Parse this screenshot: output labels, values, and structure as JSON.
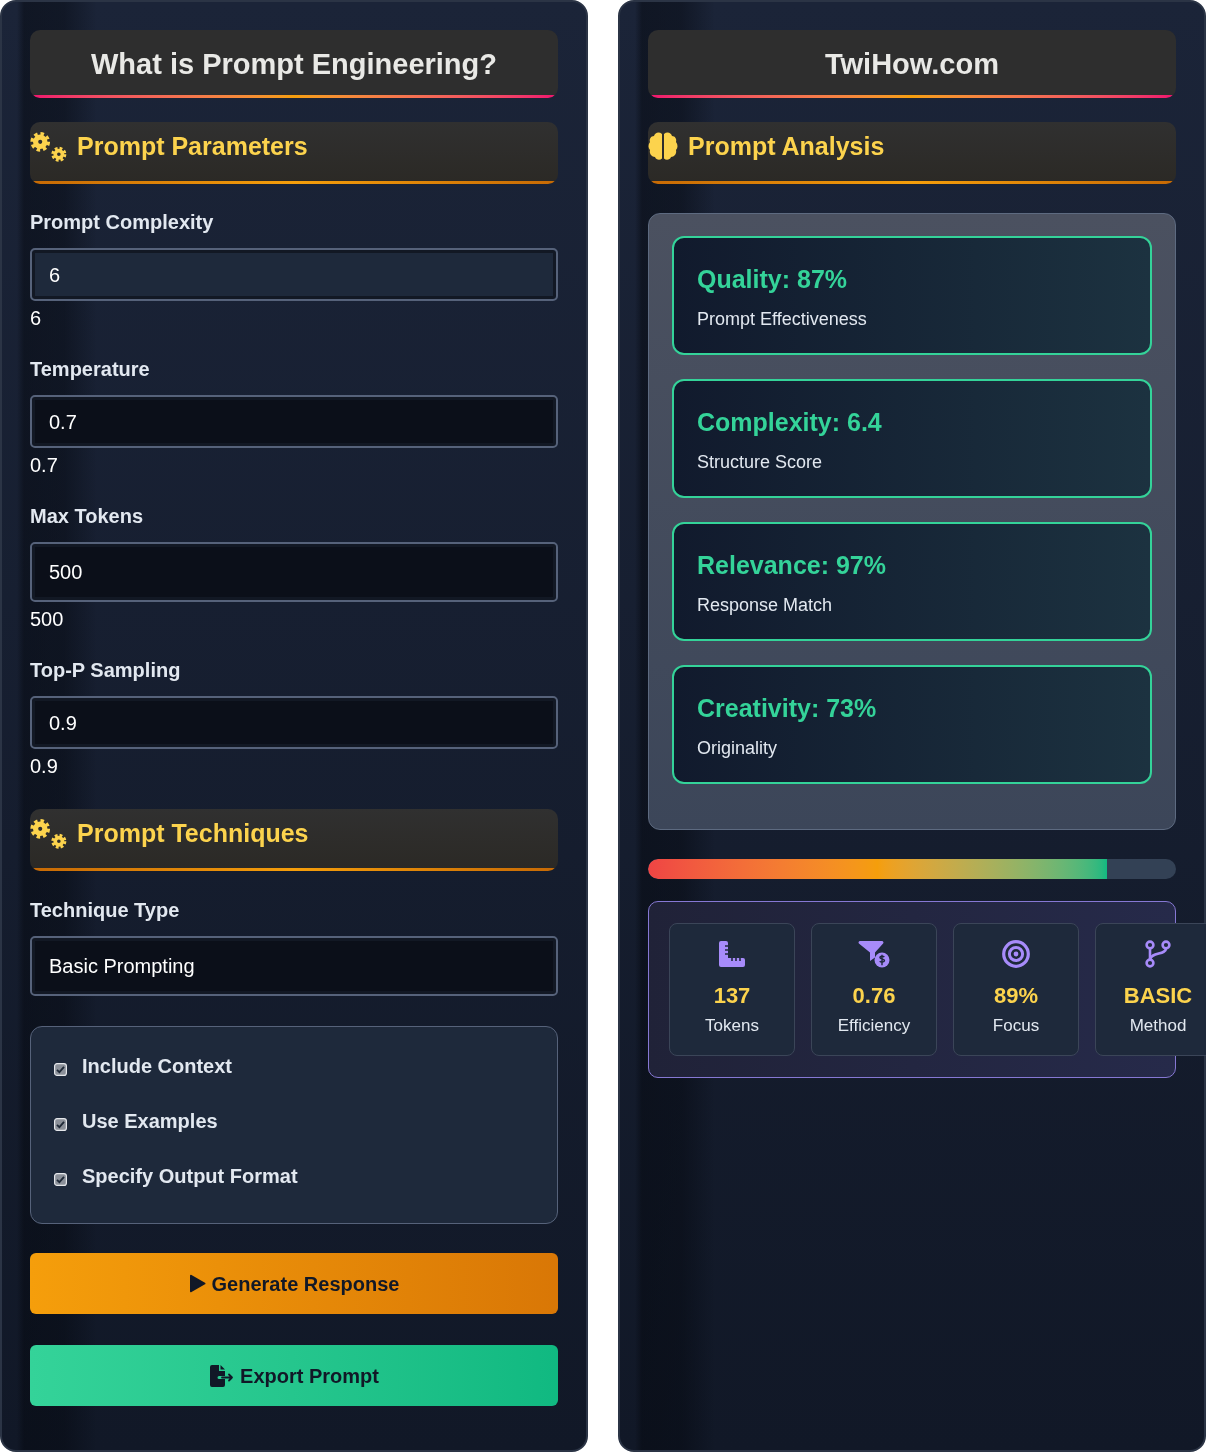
{
  "left_panel": {
    "title": "What is Prompt Engineering?",
    "parameters": {
      "heading": "Prompt Parameters",
      "fields": [
        {
          "label": "Prompt Complexity",
          "kind": "range",
          "value": "6",
          "focused": true,
          "reading": "6"
        },
        {
          "label": "Temperature",
          "kind": "range",
          "value": "0.7",
          "focused": false,
          "reading": "0.7"
        },
        {
          "label": "Max Tokens",
          "kind": "number",
          "value": "500",
          "focused": false,
          "reading": "500"
        },
        {
          "label": "Top-P Sampling",
          "kind": "range",
          "value": "0.9",
          "focused": false,
          "reading": "0.9"
        }
      ]
    },
    "techniques": {
      "heading": "Prompt Techniques",
      "select": {
        "label": "Technique Type",
        "value": "Basic Prompting"
      },
      "options": [
        {
          "label": "Include Context",
          "checked": true
        },
        {
          "label": "Use Examples",
          "checked": true
        },
        {
          "label": "Specify Output Format",
          "checked": true
        }
      ]
    },
    "buttons": [
      {
        "kind": "generate",
        "label": "Generate Response"
      },
      {
        "kind": "export",
        "label": "Export Prompt"
      }
    ]
  },
  "right_panel": {
    "title": "TwiHow.com",
    "analysis": {
      "heading": "Prompt Analysis",
      "metrics": [
        {
          "title": "Quality: 87%",
          "subtitle": "Prompt Effectiveness"
        },
        {
          "title": "Complexity: 6.4",
          "subtitle": "Structure Score"
        },
        {
          "title": "Relevance: 97%",
          "subtitle": "Response Match"
        },
        {
          "title": "Creativity: 73%",
          "subtitle": "Originality"
        }
      ]
    },
    "score_bar": {
      "level": 0.87
    },
    "stats": [
      {
        "kind": "tokens",
        "value": "137",
        "label": "Tokens"
      },
      {
        "kind": "efficiency",
        "value": "0.76",
        "label": "Efficiency"
      },
      {
        "kind": "focus",
        "value": "89%",
        "label": "Focus"
      },
      {
        "kind": "method",
        "value": "BASIC",
        "label": "Method"
      }
    ]
  }
}
